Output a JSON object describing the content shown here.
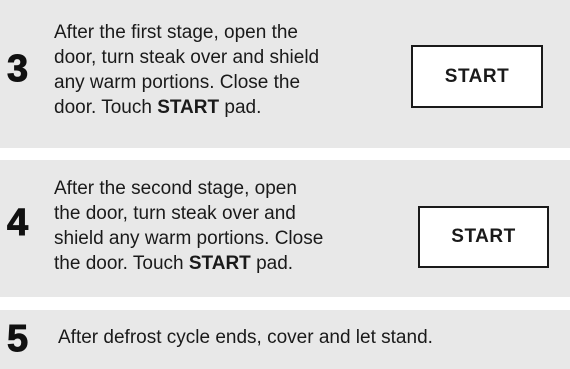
{
  "steps": [
    {
      "number": "3",
      "lines": [
        "After the first stage, open the",
        "door, turn steak over and shield",
        "any warm portions. Close the"
      ],
      "last_line_prefix": "door. Touch ",
      "last_line_bold": "START",
      "last_line_suffix": " pad.",
      "button_label": "START"
    },
    {
      "number": "4",
      "lines": [
        "After the second stage, open",
        "the door, turn steak over and",
        "shield any warm portions. Close"
      ],
      "last_line_prefix": "the door. Touch ",
      "last_line_bold": "START",
      "last_line_suffix": " pad.",
      "button_label": "START"
    },
    {
      "number": "5",
      "text": "After defrost cycle ends, cover and let stand."
    }
  ]
}
